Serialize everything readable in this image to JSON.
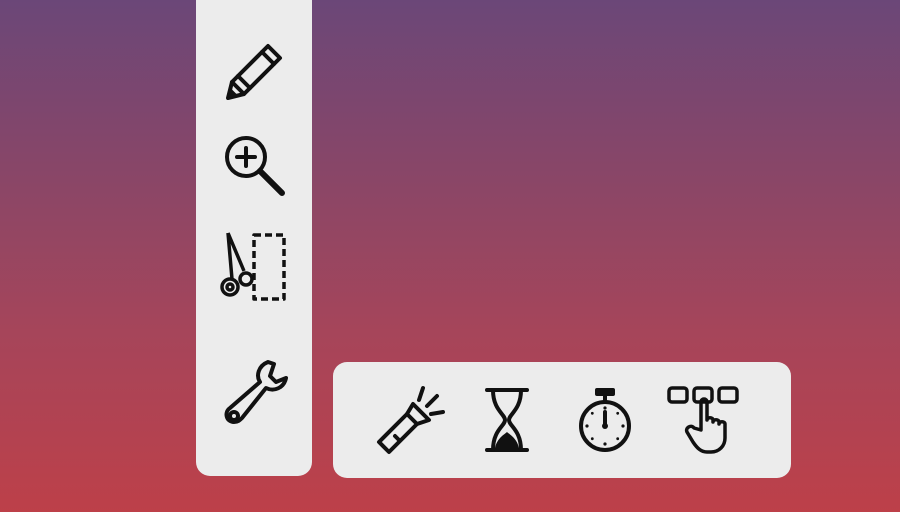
{
  "vertical_toolbar": {
    "tools": [
      {
        "icon": "pencil-icon"
      },
      {
        "icon": "zoom-in-icon"
      },
      {
        "icon": "cut-selection-icon"
      },
      {
        "icon": "wrench-icon"
      }
    ]
  },
  "horizontal_toolbar": {
    "tools": [
      {
        "icon": "flashlight-icon"
      },
      {
        "icon": "hourglass-icon"
      },
      {
        "icon": "stopwatch-icon"
      },
      {
        "icon": "tap-select-icon"
      }
    ]
  },
  "colors": {
    "panel": "#ececec",
    "icon": "#111111",
    "gradient_top": "#6b4778",
    "gradient_bottom": "#bd4049"
  }
}
